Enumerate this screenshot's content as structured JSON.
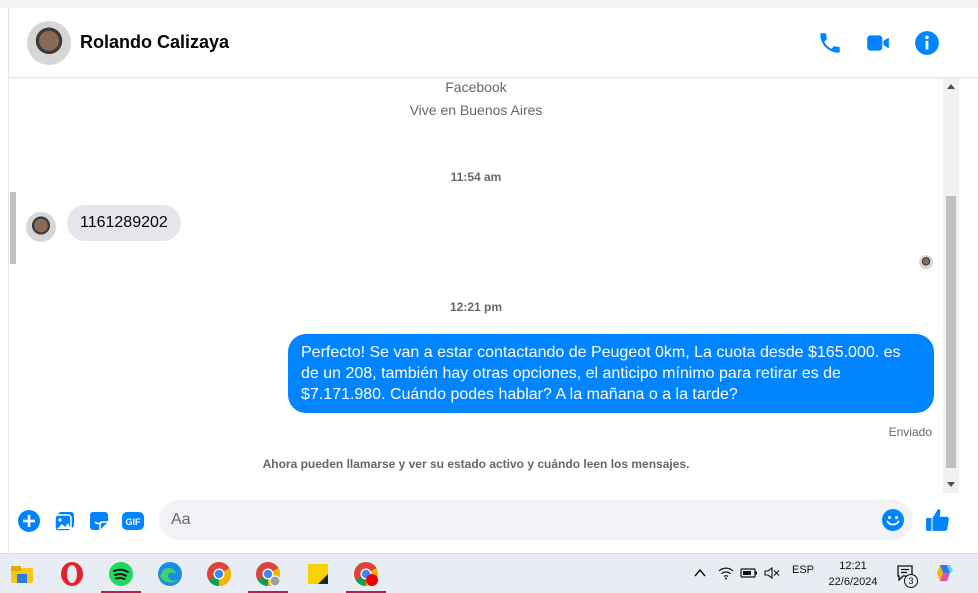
{
  "header": {
    "name": "Rolando Calizaya",
    "icons": [
      "phone-icon",
      "video-icon",
      "info-icon"
    ],
    "accent": "#0084ff"
  },
  "profile_info": {
    "platform": "Facebook",
    "location": "Vive en Buenos Aires"
  },
  "messages": [
    {
      "type": "timestamp",
      "text": "11:54 am"
    },
    {
      "type": "incoming",
      "text": "1161289202"
    },
    {
      "type": "timestamp",
      "text": "12:21 pm"
    },
    {
      "type": "outgoing",
      "text": "Perfecto!  Se van a estar contactando de Peugeot 0km, La cuota desde $165.000. es de un 208, también hay otras opciones, el anticipo mínimo para retirar es de $7.171.980. Cuándo podes hablar? A la mañana o a la tarde?",
      "status": "Enviado"
    }
  ],
  "notice": "Ahora pueden llamarse y ver su estado activo y cuándo leen los mensajes.",
  "composer": {
    "placeholder": "Aa",
    "icons": [
      "plus-icon",
      "image-icon",
      "sticker-icon",
      "gif-icon",
      "emoji-icon",
      "like-icon"
    ]
  },
  "taskbar": {
    "apps": [
      "file-explorer-icon",
      "opera-icon",
      "spotify-icon",
      "edge-icon",
      "chrome-icon",
      "chrome-profile-icon",
      "sticky-notes-icon",
      "chrome-alt-icon"
    ],
    "language": "ESP",
    "time": "12:21",
    "date": "22/6/2024",
    "notification_count": "3"
  }
}
